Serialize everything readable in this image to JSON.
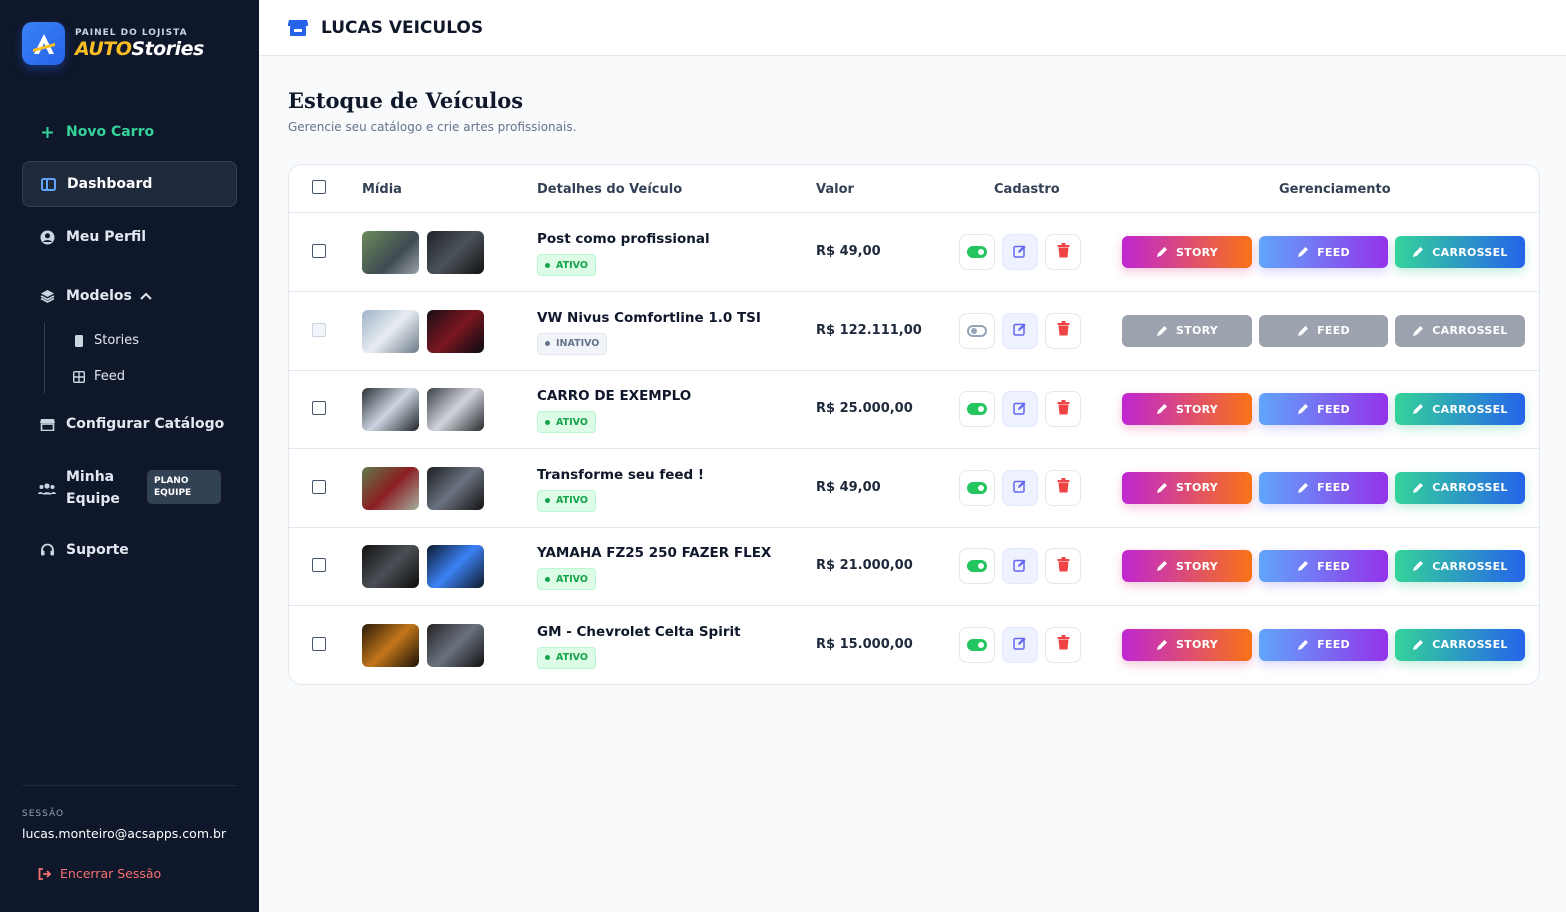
{
  "brand": {
    "subtitle": "PAINEL DO LOJISTA",
    "name_auto": "AUTO",
    "name_stories": "Stories"
  },
  "sidebar": {
    "new_car": "Novo Carro",
    "dashboard": "Dashboard",
    "profile": "Meu Perfil",
    "models": "Modelos",
    "sub_stories": "Stories",
    "sub_feed": "Feed",
    "catalog": "Configurar Catálogo",
    "team": "Minha Equipe",
    "team_badge": "PLANO EQUIPE",
    "support": "Suporte",
    "session_label": "SESSÃO",
    "session_email": "lucas.monteiro@acsapps.com.br",
    "logout": "Encerrar Sessão"
  },
  "header": {
    "store_name": "LUCAS VEICULOS"
  },
  "page": {
    "title": "Estoque de Veículos",
    "subtitle": "Gerencie seu catálogo e crie artes profissionais."
  },
  "table": {
    "columns": {
      "media": "Mídia",
      "details": "Detalhes do Veículo",
      "value": "Valor",
      "registry": "Cadastro",
      "management": "Gerenciamento"
    },
    "buttons": {
      "story": "STORY",
      "feed": "FEED",
      "carousel": "CARROSSEL"
    },
    "rows": [
      {
        "name": "Post como profissional",
        "status": "ATIVO",
        "active": true,
        "price": "R$ 49,00"
      },
      {
        "name": "VW Nivus Comfortline 1.0 TSI",
        "status": "INATIVO",
        "active": false,
        "price": "R$ 122.111,00"
      },
      {
        "name": "CARRO DE EXEMPLO",
        "status": "ATIVO",
        "active": true,
        "price": "R$ 25.000,00"
      },
      {
        "name": "Transforme seu feed !",
        "status": "ATIVO",
        "active": true,
        "price": "R$ 49,00"
      },
      {
        "name": "YAMAHA FZ25 250 FAZER FLEX",
        "status": "ATIVO",
        "active": true,
        "price": "R$ 21.000,00"
      },
      {
        "name": "GM - Chevrolet Celta Spirit",
        "status": "ATIVO",
        "active": true,
        "price": "R$ 15.000,00"
      }
    ]
  },
  "colors": {
    "sidebar_bg": "#0f172a",
    "accent_green": "#34d399",
    "active_status": "#16a34a",
    "danger": "#ef4444"
  },
  "icons": [
    "plus-icon",
    "dashboard-icon",
    "user-icon",
    "layers-icon",
    "chevron-up-icon",
    "phone-icon",
    "grid-icon",
    "store-icon",
    "team-icon",
    "headset-icon",
    "logout-icon",
    "toggle-icon",
    "edit-icon",
    "trash-icon",
    "pencil-icon"
  ]
}
